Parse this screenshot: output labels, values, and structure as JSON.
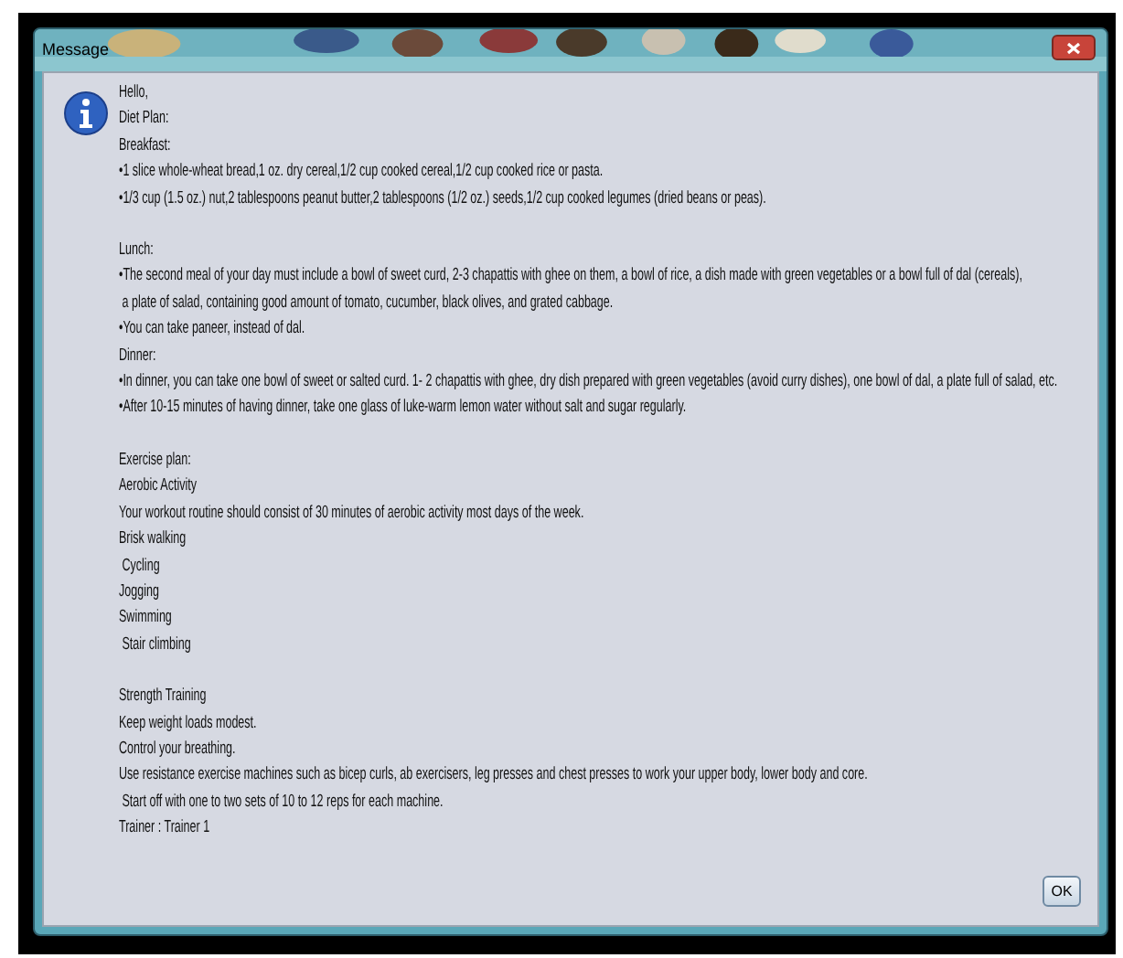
{
  "window": {
    "title": "Message"
  },
  "message": {
    "sections": [
      [
        "Hello,",
        "Diet Plan:",
        "Breakfast:",
        "•1 slice whole-wheat bread,1 oz. dry cereal,1/2 cup cooked cereal,1/2 cup cooked rice or pasta.",
        "•1/3 cup (1.5 oz.) nut,2 tablespoons peanut butter,2 tablespoons (1/2 oz.) seeds,1/2 cup cooked legumes (dried beans or peas)."
      ],
      [
        "Lunch:",
        "•The second meal of your day must include a bowl of sweet curd, 2-3 chapattis with ghee on them, a bowl of rice, a dish made with green vegetables or a bowl full of dal (cereals),",
        " a plate of salad, containing good amount of tomato, cucumber, black olives, and grated cabbage.",
        "•You can take paneer, instead of dal.",
        "Dinner:",
        "•In dinner, you can take one bowl of sweet or salted curd. 1- 2 chapattis with ghee, dry dish prepared with green vegetables (avoid curry dishes), one bowl of dal, a plate full of salad, etc.",
        "•After 10-15 minutes of having dinner, take one glass of luke-warm lemon water without salt and sugar regularly."
      ],
      [
        "Exercise plan:",
        "Aerobic Activity",
        "Your workout routine should consist of 30 minutes of aerobic activity most days of the week.",
        "Brisk walking",
        " Cycling",
        "Jogging",
        "Swimming",
        " Stair climbing"
      ],
      [
        "Strength Training",
        "Keep weight loads modest.",
        "Control your breathing.",
        "Use resistance exercise machines such as bicep curls, ab exercisers, leg presses and chest presses to work your upper body, lower body and core.",
        " Start off with one to two sets of 10 to 12 reps for each machine.",
        "Trainer : Trainer 1"
      ]
    ]
  },
  "buttons": [
    "OK"
  ]
}
